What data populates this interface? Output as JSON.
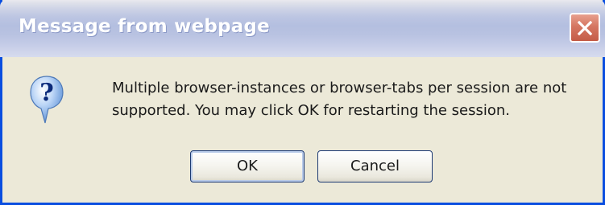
{
  "dialog": {
    "title": "Message from webpage",
    "message_line1": "Multiple browser-instances or browser-tabs per session are not",
    "message_line2": "supported. You may click OK for restarting the session.",
    "ok_label": "OK",
    "cancel_label": "Cancel",
    "icon": "question-icon",
    "close_icon": "close-icon"
  },
  "colors": {
    "title_bar": "#b8c2e1",
    "close_button": "#d57661",
    "window_border": "#0a4ee0",
    "dialog_background": "#ece9d8"
  }
}
